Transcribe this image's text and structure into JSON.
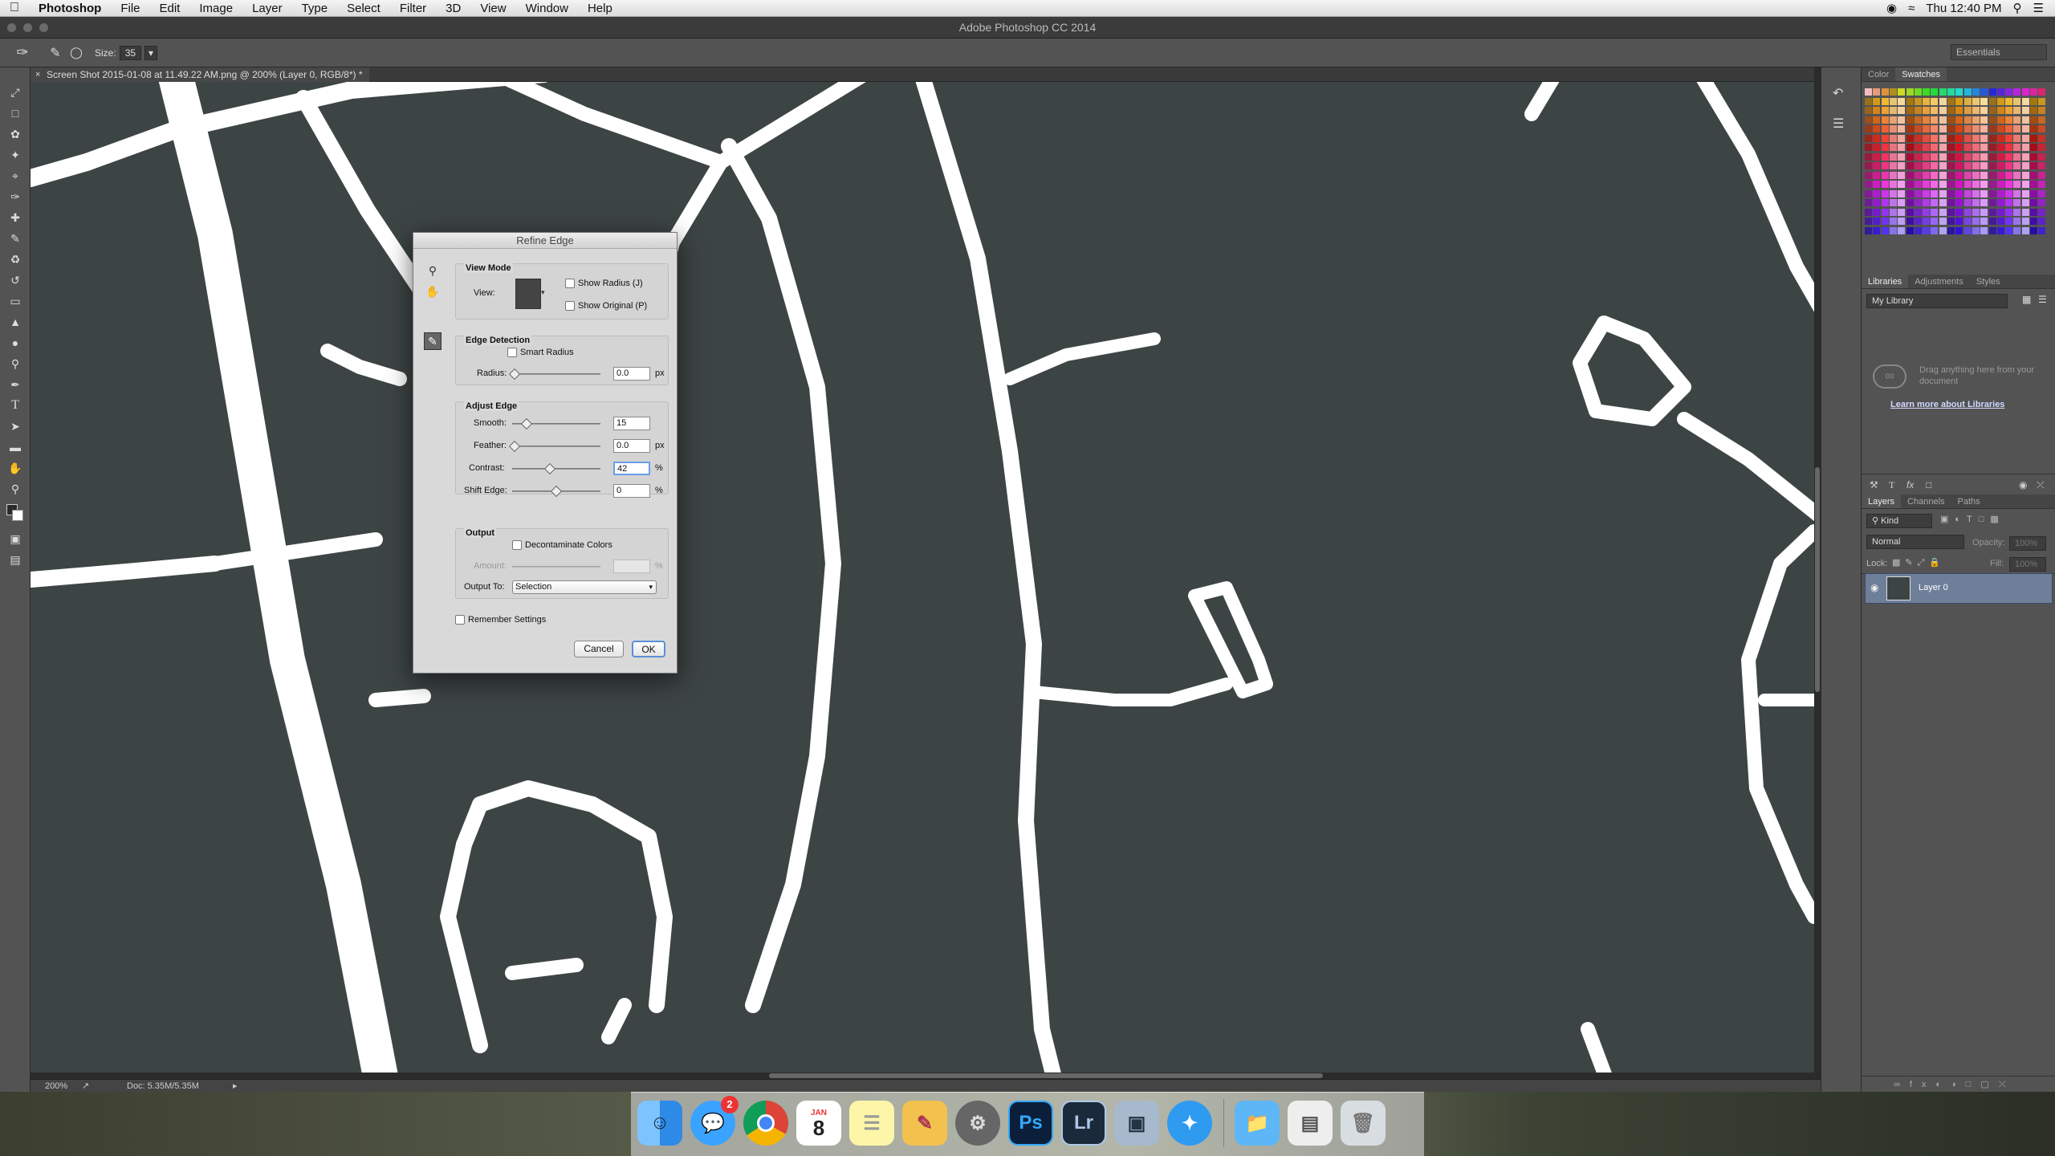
{
  "menubar": {
    "app": "Photoshop",
    "items": [
      "File",
      "Edit",
      "Image",
      "Layer",
      "Type",
      "Select",
      "Filter",
      "3D",
      "View",
      "Window",
      "Help"
    ],
    "clock": "Thu 12:40 PM"
  },
  "window": {
    "title": "Adobe Photoshop CC 2014"
  },
  "options": {
    "size_label": "Size:",
    "size_value": "35",
    "workspace": "Essentials"
  },
  "document": {
    "tab_title": "Screen Shot 2015-01-08 at 11.49.22 AM.png @ 200% (Layer 0, RGB/8*) *",
    "close": "×"
  },
  "status": {
    "zoom": "200%",
    "doc": "Doc: 5.35M/5.35M"
  },
  "panels": {
    "color_tabs": [
      "Color",
      "Swatches"
    ],
    "lib_tabs": [
      "Libraries",
      "Adjustments",
      "Styles"
    ],
    "library_select": "My Library",
    "lib_hint": "Drag anything here from your document",
    "lib_link": "Learn more about Libraries",
    "layer_tabs": [
      "Layers",
      "Channels",
      "Paths"
    ],
    "kind": "Kind",
    "blend": "Normal",
    "opacity_label": "Opacity:",
    "opacity_value": "100%",
    "lock_label": "Lock:",
    "fill_label": "Fill:",
    "fill_value": "100%",
    "layer_name": "Layer 0"
  },
  "dialog": {
    "title": "Refine Edge",
    "view_mode": "View Mode",
    "view_label": "View:",
    "show_radius": "Show Radius (J)",
    "show_original": "Show Original (P)",
    "edge_detection": "Edge Detection",
    "smart_radius": "Smart Radius",
    "radius_label": "Radius:",
    "radius_value": "0.0",
    "px": "px",
    "adjust_edge": "Adjust Edge",
    "smooth_label": "Smooth:",
    "smooth_value": "15",
    "feather_label": "Feather:",
    "feather_value": "0.0",
    "contrast_label": "Contrast:",
    "contrast_value": "42",
    "shift_label": "Shift Edge:",
    "shift_value": "0",
    "percent": "%",
    "output": "Output",
    "decontaminate": "Decontaminate Colors",
    "amount_label": "Amount:",
    "output_to_label": "Output To:",
    "output_to_value": "Selection",
    "remember": "Remember Settings",
    "cancel": "Cancel",
    "ok": "OK"
  },
  "dock": {
    "calendar_month": "JAN",
    "calendar_day": "8",
    "mail_badge": "2",
    "ps": "Ps",
    "lr": "Lr"
  },
  "colors": {
    "canvas_bg": "#3d4444",
    "road": "#ffffff",
    "accent": "#6e7f99"
  }
}
